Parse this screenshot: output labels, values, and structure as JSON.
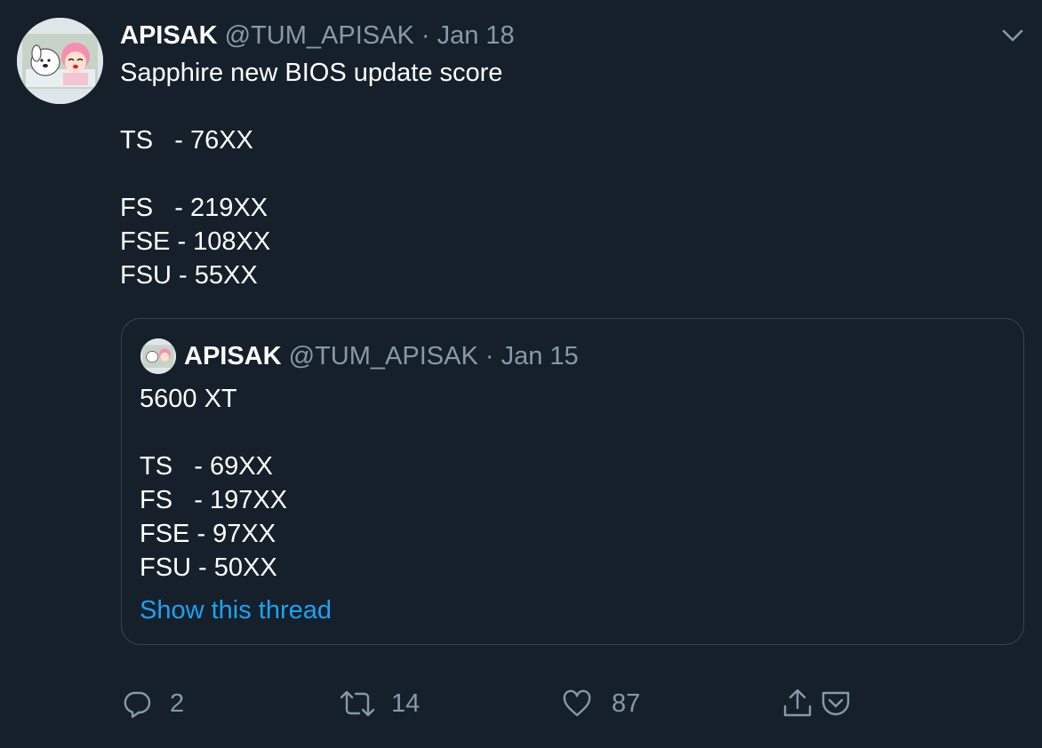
{
  "tweet": {
    "author_name": "APISAK",
    "author_handle": "@TUM_APISAK",
    "separator": "·",
    "date": "Jan 18",
    "text": "Sapphire new BIOS update score\n\nTS   - 76XX\n\nFS   - 219XX\nFSE - 108XX\nFSU - 55XX"
  },
  "quoted_tweet": {
    "author_name": "APISAK",
    "author_handle": "@TUM_APISAK",
    "separator": "·",
    "date": "Jan 15",
    "text": "5600 XT\n\nTS   - 69XX\nFS   - 197XX\nFSE - 97XX\nFSU - 50XX",
    "show_thread_label": "Show this thread"
  },
  "actions": {
    "reply_count": "2",
    "retweet_count": "14",
    "like_count": "87"
  },
  "icons": {
    "more": "chevron-down-icon",
    "reply": "reply-icon",
    "retweet": "retweet-icon",
    "like": "heart-icon",
    "share": "share-icon",
    "pocket": "pocket-icon"
  },
  "colors": {
    "background": "#15202b",
    "text": "#ffffff",
    "secondary_text": "#8899a6",
    "link": "#1da1f2",
    "border": "#38444d"
  }
}
